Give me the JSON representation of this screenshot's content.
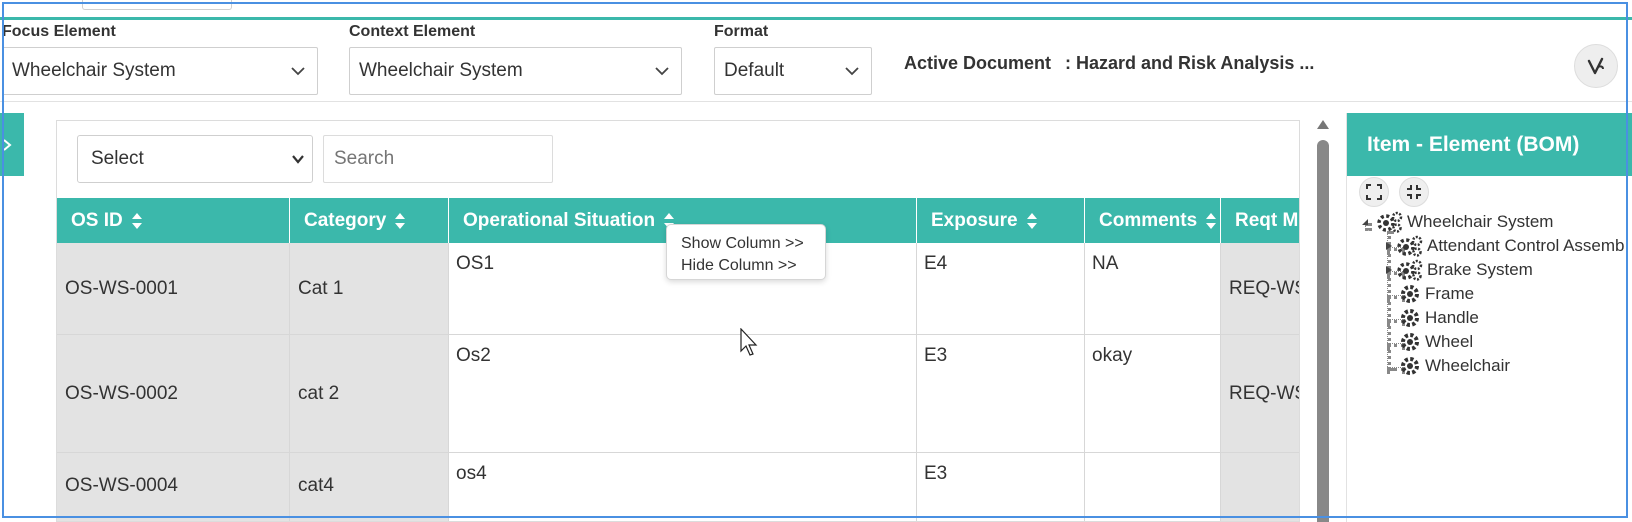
{
  "filters": {
    "focus": {
      "label": "Focus Element",
      "value": "Wheelchair System"
    },
    "context": {
      "label": "Context Element",
      "value": "Wheelchair System"
    },
    "format": {
      "label": "Format",
      "value": "Default"
    },
    "active_document": {
      "label": "Active Document",
      "value": ": Hazard and Risk Analysis ..."
    }
  },
  "table_toolbar": {
    "select_value": "Select",
    "search_placeholder": "Search"
  },
  "table": {
    "columns": [
      "OS ID",
      "Category",
      "Operational Situation",
      "Exposure",
      "Comments",
      "Reqt M"
    ],
    "rows": [
      {
        "os_id": "OS-WS-0001",
        "category": "Cat 1",
        "situation": "OS1",
        "exposure": "E4",
        "comments": "NA",
        "reqt": "REQ-WS"
      },
      {
        "os_id": "OS-WS-0002",
        "category": "cat 2",
        "situation": "Os2",
        "exposure": "E3",
        "comments": "okay",
        "reqt": "REQ-WS"
      },
      {
        "os_id": "OS-WS-0004",
        "category": "cat4",
        "situation": "os4",
        "exposure": "E3",
        "comments": "",
        "reqt": ""
      }
    ]
  },
  "context_menu": {
    "items": [
      "Show Column >>",
      "Hide Column >>"
    ]
  },
  "bom": {
    "title": "Item - Element (BOM)",
    "tree": {
      "root": "Wheelchair System",
      "children": [
        "Attendant Control Assemb",
        "Brake System",
        "Frame",
        "Handle",
        "Wheel",
        "Wheelchair"
      ]
    }
  },
  "colors": {
    "accent": "#3bb8ab",
    "cell_gray": "#e3e3e3",
    "outline": "#4a90e2"
  },
  "icons": {
    "chevron": "chevron-down-icon",
    "sort": "sort-icon",
    "gear": "gear-icon",
    "expand": "expand-icon",
    "collapse": "collapse-icon",
    "logo": "v-logo-icon",
    "side_toggle": "panel-toggle-icon"
  }
}
